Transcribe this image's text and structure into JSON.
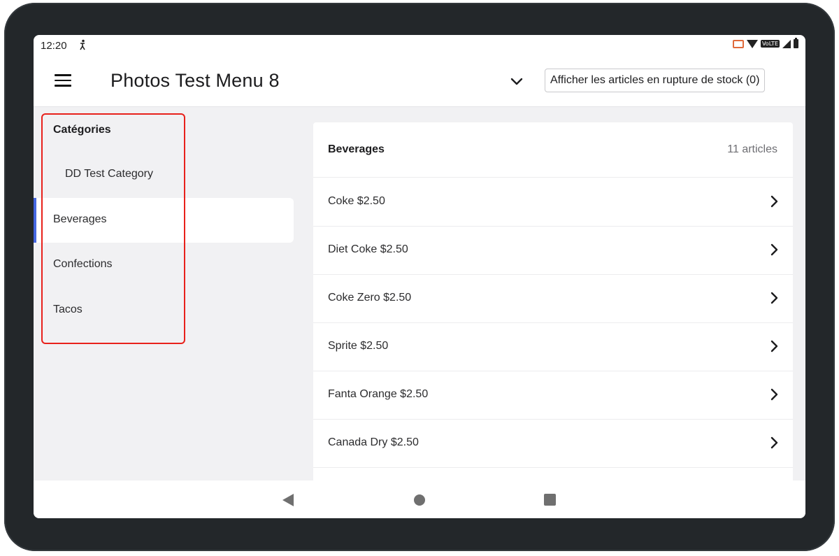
{
  "status_bar": {
    "time": "12:20",
    "volte_label": "VoLTE"
  },
  "app_bar": {
    "title": "Photos Test Menu 8",
    "out_of_stock_button": "Afficher les articles en rupture de stock (0)"
  },
  "sidebar": {
    "heading": "Catégories",
    "items": [
      {
        "label": "DD Test Category",
        "sub": true,
        "active": false
      },
      {
        "label": "Beverages",
        "sub": false,
        "active": true
      },
      {
        "label": "Confections",
        "sub": false,
        "active": false
      },
      {
        "label": "Tacos",
        "sub": false,
        "active": false
      }
    ]
  },
  "panel": {
    "title": "Beverages",
    "count": "11 articles",
    "items": [
      {
        "label": "Coke $2.50"
      },
      {
        "label": "Diet Coke $2.50"
      },
      {
        "label": "Coke Zero $2.50"
      },
      {
        "label": "Sprite $2.50"
      },
      {
        "label": "Fanta Orange $2.50"
      },
      {
        "label": "Canada Dry $2.50"
      },
      {
        "label": ""
      }
    ]
  },
  "colors": {
    "accent": "#4466e0",
    "highlight": "#e8211b",
    "background": "#f1f1f3"
  }
}
